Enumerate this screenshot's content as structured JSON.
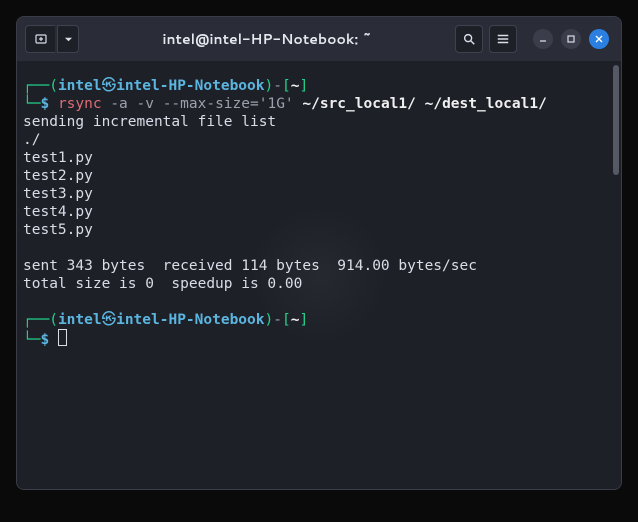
{
  "titlebar": {
    "title": "intel@intel-HP-Notebook: ~"
  },
  "prompt1": {
    "lbr": "┌──",
    "paren_open": "(",
    "user": "intel",
    "emoji": "㉿",
    "host": "intel-HP-Notebook",
    "paren_close": ")",
    "dash": "-",
    "br_open": "[",
    "cwd": "~",
    "br_close": "]",
    "lbot": "└─",
    "dollar": "$",
    "cmd_name": "rsync",
    "cmd_flags": " -a -v --max-size='1G' ",
    "cmd_args": "~/src_local1/ ~/dest_local1/"
  },
  "output": {
    "l1": "sending incremental file list",
    "l2": "./",
    "l3": "test1.py",
    "l4": "test2.py",
    "l5": "test3.py",
    "l6": "test4.py",
    "l7": "test5.py",
    "l8": "",
    "l9": "sent 343 bytes  received 114 bytes  914.00 bytes/sec",
    "l10": "total size is 0  speedup is 0.00"
  },
  "prompt2": {
    "lbr": "┌──",
    "paren_open": "(",
    "user": "intel",
    "emoji": "㉿",
    "host": "intel-HP-Notebook",
    "paren_close": ")",
    "dash": "-",
    "br_open": "[",
    "cwd": "~",
    "br_close": "]",
    "lbot": "└─",
    "dollar": "$"
  }
}
